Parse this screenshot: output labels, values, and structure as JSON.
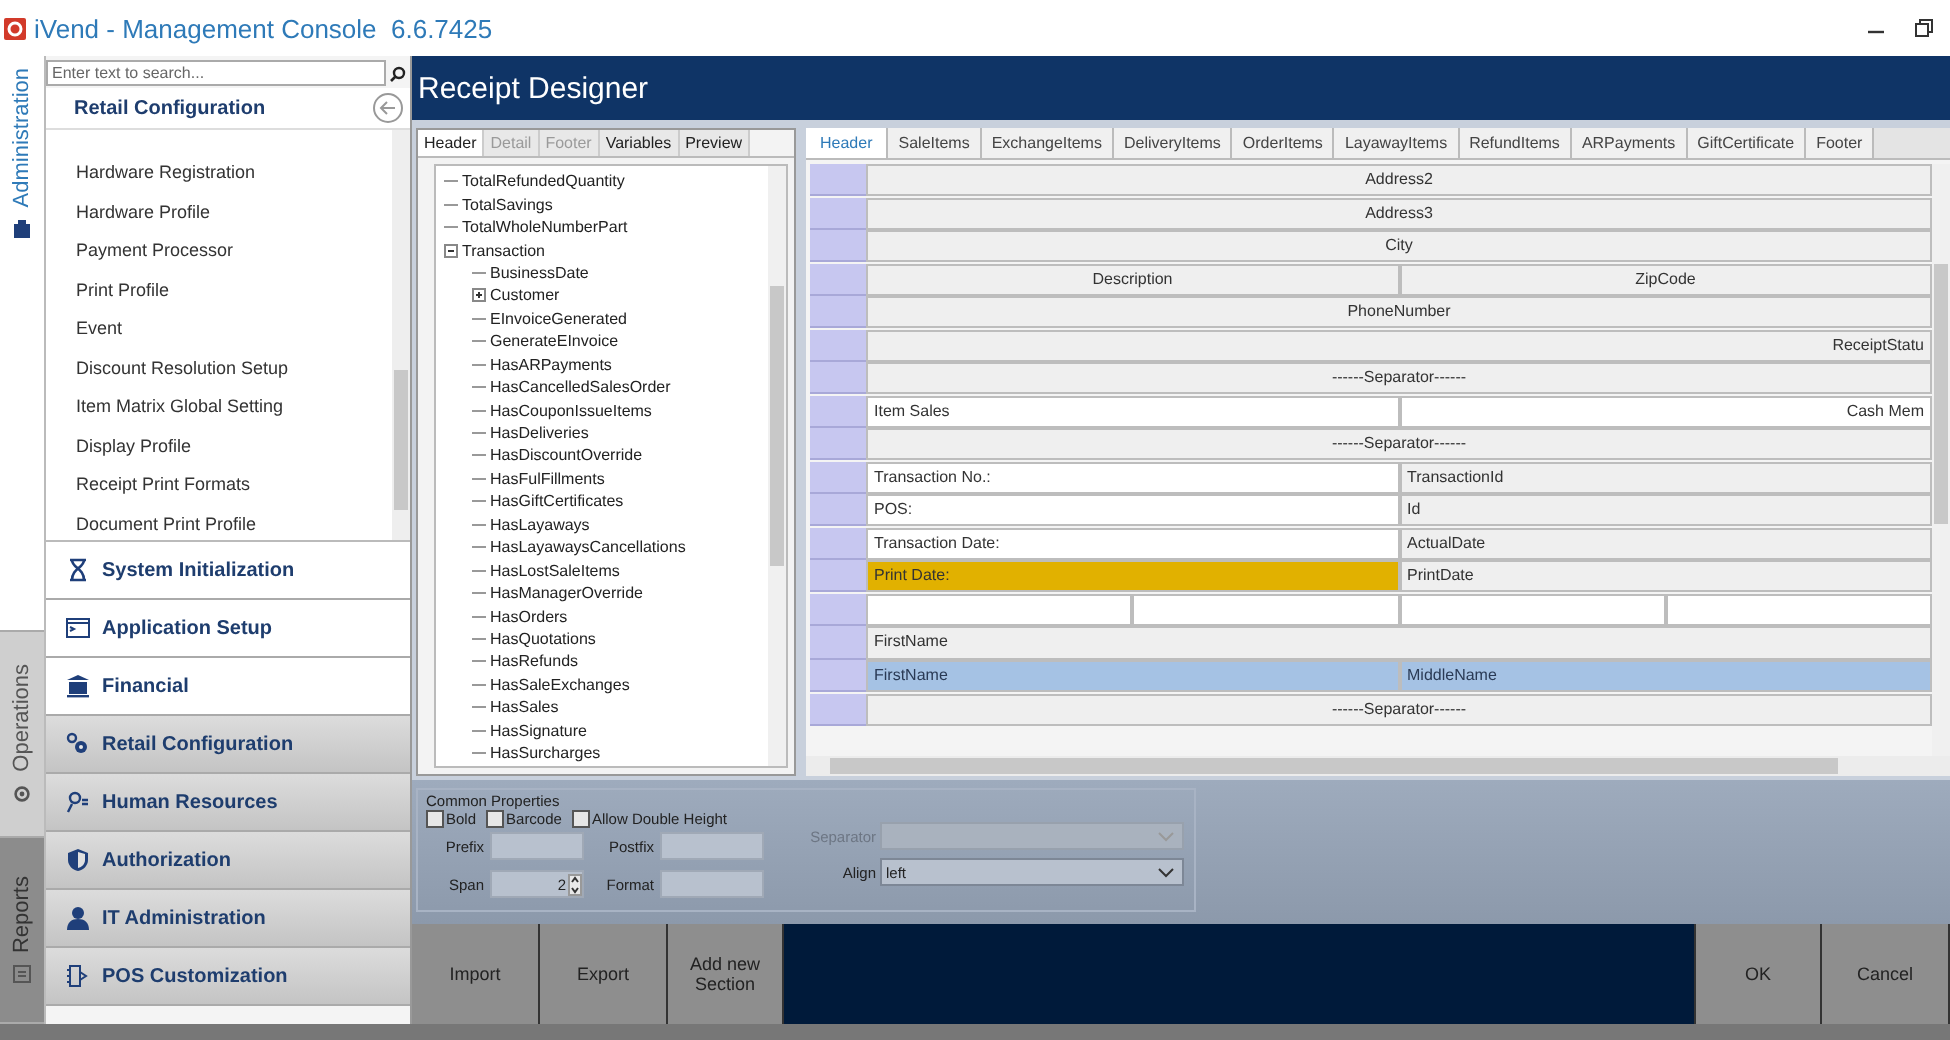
{
  "window": {
    "title": "iVend - Management Console  6.6.7425"
  },
  "side_tabs": [
    {
      "label": "Administration",
      "selected": true
    },
    {
      "label": "Operations",
      "selected": false
    },
    {
      "label": "Reports",
      "selected": false
    }
  ],
  "navigator": {
    "search": {
      "placeholder": "Enter text to search..."
    },
    "title": "Retail Configuration",
    "items": [
      "Hardware Registration",
      "Hardware Profile",
      "Payment Processor",
      "Print Profile",
      "Event",
      "Discount Resolution Setup",
      "Item Matrix Global Setting",
      "Display Profile",
      "Receipt Print Formats",
      "Document Print Profile"
    ],
    "sections": [
      "System Initialization",
      "Application Setup",
      "Financial",
      "Retail Configuration",
      "Human Resources",
      "Authorization",
      "IT Administration",
      "POS Customization"
    ]
  },
  "designer": {
    "title": "Receipt Designer",
    "tree_tabs": [
      {
        "label": "Header",
        "selected": true,
        "disabled": false
      },
      {
        "label": "Detail",
        "selected": false,
        "disabled": true
      },
      {
        "label": "Footer",
        "selected": false,
        "disabled": true
      },
      {
        "label": "Variables",
        "selected": false,
        "disabled": false
      },
      {
        "label": "Preview",
        "selected": false,
        "disabled": false
      }
    ],
    "tree": [
      {
        "label": "TotalRefundedQuantity"
      },
      {
        "label": "TotalSavings"
      },
      {
        "label": "TotalWholeNumberPart"
      },
      {
        "label": "Transaction",
        "expanded": true,
        "children": [
          {
            "label": "BusinessDate"
          },
          {
            "label": "Customer",
            "expanded": false
          },
          {
            "label": "EInvoiceGenerated"
          },
          {
            "label": "GenerateEInvoice"
          },
          {
            "label": "HasARPayments"
          },
          {
            "label": "HasCancelledSalesOrder"
          },
          {
            "label": "HasCouponIssueItems"
          },
          {
            "label": "HasDeliveries"
          },
          {
            "label": "HasDiscountOverride"
          },
          {
            "label": "HasFulFillments"
          },
          {
            "label": "HasGiftCertificates"
          },
          {
            "label": "HasLayaways"
          },
          {
            "label": "HasLayawaysCancellations"
          },
          {
            "label": "HasLostSaleItems"
          },
          {
            "label": "HasManagerOverride"
          },
          {
            "label": "HasOrders"
          },
          {
            "label": "HasQuotations"
          },
          {
            "label": "HasRefunds"
          },
          {
            "label": "HasSaleExchanges"
          },
          {
            "label": "HasSales"
          },
          {
            "label": "HasSignature"
          },
          {
            "label": "HasSurcharges"
          }
        ]
      }
    ],
    "section_tabs": [
      {
        "label": "Header",
        "selected": true
      },
      {
        "label": "SaleItems",
        "selected": false
      },
      {
        "label": "ExchangeItems",
        "selected": false
      },
      {
        "label": "DeliveryItems",
        "selected": false
      },
      {
        "label": "OrderItems",
        "selected": false
      },
      {
        "label": "LayawayItems",
        "selected": false
      },
      {
        "label": "RefundItems",
        "selected": false
      },
      {
        "label": "ARPayments",
        "selected": false
      },
      {
        "label": "GiftCertificate",
        "selected": false
      },
      {
        "label": "Footer",
        "selected": false
      }
    ],
    "grid_rows": [
      {
        "selected": false,
        "cells": [
          {
            "text": "Address2",
            "kind": "centered"
          }
        ]
      },
      {
        "selected": false,
        "cells": [
          {
            "text": "Address3",
            "kind": "centered"
          }
        ]
      },
      {
        "selected": false,
        "cells": [
          {
            "text": "City",
            "kind": "centered"
          }
        ]
      },
      {
        "selected": false,
        "cells": [
          {
            "text": "Description",
            "kind": "centered"
          },
          {
            "text": "ZipCode",
            "kind": "centered"
          }
        ]
      },
      {
        "selected": false,
        "cells": [
          {
            "text": "PhoneNumber",
            "kind": "centered"
          }
        ]
      },
      {
        "selected": false,
        "cells": [
          {
            "text": "ReceiptStatu",
            "kind": "right"
          }
        ]
      },
      {
        "selected": false,
        "cells": [
          {
            "text": "------Separator------",
            "kind": "centered"
          }
        ]
      },
      {
        "selected": false,
        "cells": [
          {
            "text": "Item Sales",
            "kind": "field-left"
          },
          {
            "text": "Cash Mem",
            "kind": "field-right"
          }
        ]
      },
      {
        "selected": false,
        "cells": [
          {
            "text": "------Separator------",
            "kind": "centered"
          }
        ]
      },
      {
        "selected": false,
        "cells": [
          {
            "text": "Transaction No.:",
            "kind": "field-left"
          },
          {
            "text": "TransactionId",
            "kind": "left"
          }
        ]
      },
      {
        "selected": false,
        "cells": [
          {
            "text": "POS:",
            "kind": "field-left"
          },
          {
            "text": "Id",
            "kind": "left"
          }
        ]
      },
      {
        "selected": false,
        "cells": [
          {
            "text": "Transaction Date:",
            "kind": "field-left"
          },
          {
            "text": "ActualDate",
            "kind": "left"
          }
        ]
      },
      {
        "selected": false,
        "cells": [
          {
            "text": "Print Date:",
            "kind": "highlight"
          },
          {
            "text": "PrintDate",
            "kind": "left"
          }
        ]
      },
      {
        "selected": false,
        "cells": [
          {
            "kind": "field-left"
          },
          {
            "kind": "field-left"
          },
          {
            "kind": "field-left"
          },
          {
            "kind": "field-left"
          }
        ]
      },
      {
        "selected": false,
        "cells": [
          {
            "text": "FirstName",
            "kind": "left"
          }
        ]
      },
      {
        "selected": true,
        "cells": [
          {
            "text": "FirstName",
            "kind": "left"
          },
          {
            "text": "MiddleName",
            "kind": "left"
          }
        ]
      },
      {
        "selected": false,
        "cells": [
          {
            "text": "------Separator------",
            "kind": "centered"
          }
        ]
      }
    ],
    "properties": {
      "title": "Common Properties",
      "checkboxes": [
        {
          "label": "Bold",
          "checked": false
        },
        {
          "label": "Barcode",
          "checked": false
        },
        {
          "label": "Allow Double Height",
          "checked": false
        }
      ],
      "fields": [
        {
          "label": "Prefix",
          "kind": "text"
        },
        {
          "label": "Postfix",
          "kind": "text"
        },
        {
          "label": "Span",
          "value": "2",
          "kind": "spin"
        },
        {
          "label": "Format",
          "kind": "text"
        }
      ],
      "dropdowns": [
        {
          "label": "Separator",
          "disabled": true
        },
        {
          "label": "Align",
          "value": "left",
          "disabled": false
        }
      ]
    },
    "buttons_left": [
      "Import",
      "Export",
      "Add new Section"
    ],
    "buttons_right": [
      "OK",
      "Cancel"
    ]
  }
}
